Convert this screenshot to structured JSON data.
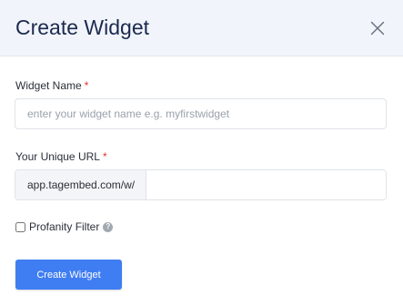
{
  "modal": {
    "title": "Create Widget",
    "close_icon": "close-icon"
  },
  "form": {
    "widget_name": {
      "label": "Widget Name",
      "required_mark": "*",
      "placeholder": "enter your widget name e.g. myfirstwidget",
      "value": ""
    },
    "unique_url": {
      "label": "Your Unique URL",
      "required_mark": "*",
      "prefix": "app.tagembed.com/w/",
      "value": ""
    },
    "profanity_filter": {
      "label": "Profanity Filter",
      "checked": false,
      "help_icon": "question-circle-icon",
      "help_glyph": "?"
    },
    "submit": {
      "label": "Create Widget"
    }
  },
  "colors": {
    "header_bg": "#f1f5fb",
    "title": "#1c2a4d",
    "required": "#e0322f",
    "primary_button": "#3f7df2"
  }
}
